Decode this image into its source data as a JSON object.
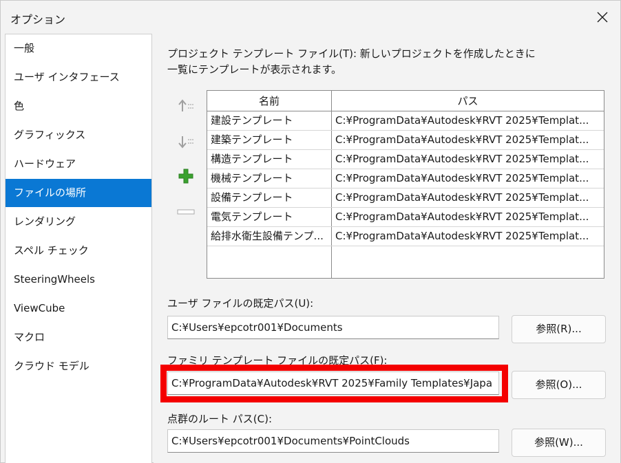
{
  "window": {
    "title": "オプション"
  },
  "sidebar": {
    "items": [
      {
        "label": "一般"
      },
      {
        "label": "ユーザ インタフェース"
      },
      {
        "label": "色"
      },
      {
        "label": "グラフィックス"
      },
      {
        "label": "ハードウェア"
      },
      {
        "label": "ファイルの場所",
        "selected": true
      },
      {
        "label": "レンダリング"
      },
      {
        "label": "スペル チェック"
      },
      {
        "label": "SteeringWheels"
      },
      {
        "label": "ViewCube"
      },
      {
        "label": "マクロ"
      },
      {
        "label": "クラウド モデル"
      }
    ]
  },
  "templates": {
    "description_line1": "プロジェクト テンプレート ファイル(T):  新しいプロジェクトを作成したときに",
    "description_line2": "一覧にテンプレートが表示されます。",
    "columns": {
      "name": "名前",
      "path": "パス"
    },
    "rows": [
      {
        "name": "建設テンプレート",
        "path": "C:¥ProgramData¥Autodesk¥RVT 2025¥Templat..."
      },
      {
        "name": "建築テンプレート",
        "path": "C:¥ProgramData¥Autodesk¥RVT 2025¥Templat..."
      },
      {
        "name": "構造テンプレート",
        "path": "C:¥ProgramData¥Autodesk¥RVT 2025¥Templat..."
      },
      {
        "name": "機械テンプレート",
        "path": "C:¥ProgramData¥Autodesk¥RVT 2025¥Templat..."
      },
      {
        "name": "設備テンプレート",
        "path": "C:¥ProgramData¥Autodesk¥RVT 2025¥Templat..."
      },
      {
        "name": "電気テンプレート",
        "path": "C:¥ProgramData¥Autodesk¥RVT 2025¥Templat..."
      },
      {
        "name": "給排水衛生設備テンプ...",
        "path": "C:¥ProgramData¥Autodesk¥RVT 2025¥Templat..."
      }
    ],
    "tools": {
      "move_up_icon": "move-up-icon",
      "move_down_icon": "move-down-icon",
      "add_icon": "plus-icon",
      "remove_icon": "minus-icon"
    }
  },
  "user_files": {
    "label": "ユーザ ファイルの既定パス(U):",
    "value": "C:¥Users¥epcotr001¥Documents",
    "browse": "参照(R)..."
  },
  "family_templates": {
    "label": "ファミリ テンプレート ファイルの既定パス(F):",
    "value": "C:¥ProgramData¥Autodesk¥RVT 2025¥Family Templates¥Japa",
    "browse": "参照(O)..."
  },
  "point_clouds": {
    "label": "点群のルート パス(C):",
    "value": "C:¥Users¥epcotr001¥Documents¥PointClouds",
    "browse": "参照(W)..."
  },
  "colors": {
    "accent": "#0a78d4",
    "highlight": "#f40000",
    "add_icon": "#3aa12e"
  }
}
